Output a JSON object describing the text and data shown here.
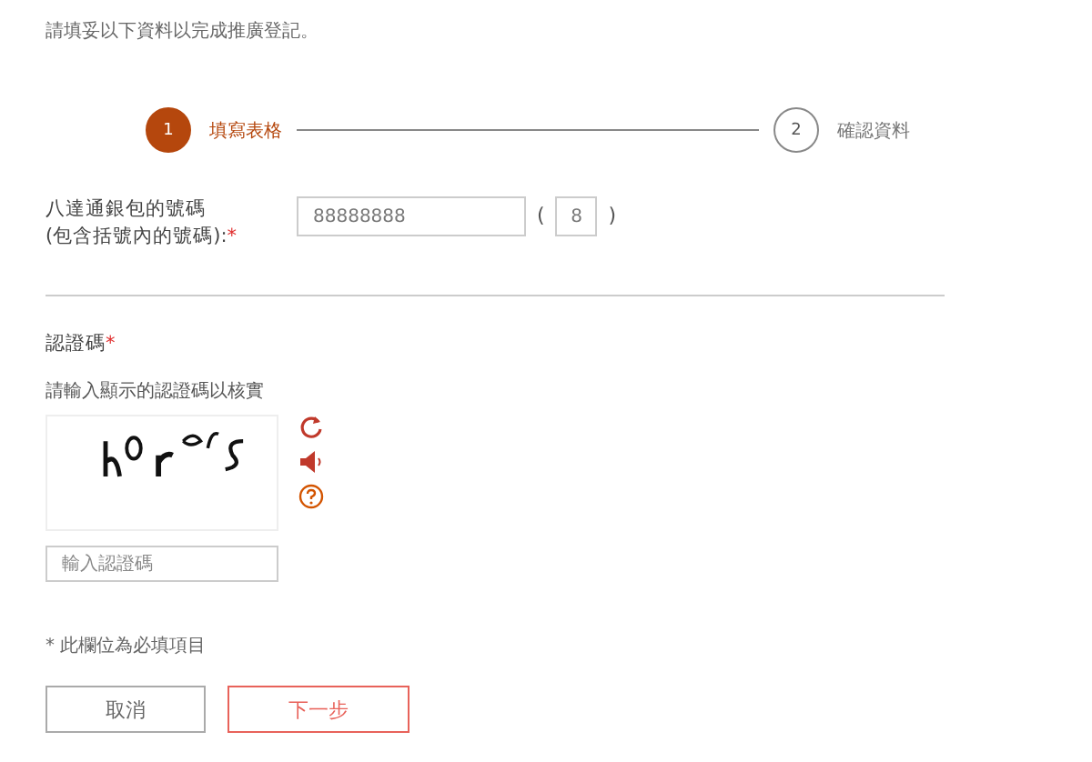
{
  "intro": "請填妥以下資料以完成推廣登記。",
  "steps": [
    {
      "number": "1",
      "label": "填寫表格",
      "selected": true
    },
    {
      "number": "2",
      "label": "確認資料",
      "selected": false
    }
  ],
  "card_field": {
    "label_line1": "八達通銀包的號碼",
    "label_line2": "(包含括號內的號碼):",
    "required_mark": "*",
    "value": "88888888",
    "open_paren": "(",
    "check_digit": "8",
    "close_paren": ")"
  },
  "captcha": {
    "title": "認證碼",
    "required_mark": "*",
    "hint": "請輸入顯示的認證碼以核實",
    "placeholder": "輸入認證碼"
  },
  "required_note": "* 此欄位為必填項目",
  "buttons": [
    {
      "label": "取消",
      "kind": "secondary"
    },
    {
      "label": "下一步",
      "kind": "primary"
    }
  ]
}
